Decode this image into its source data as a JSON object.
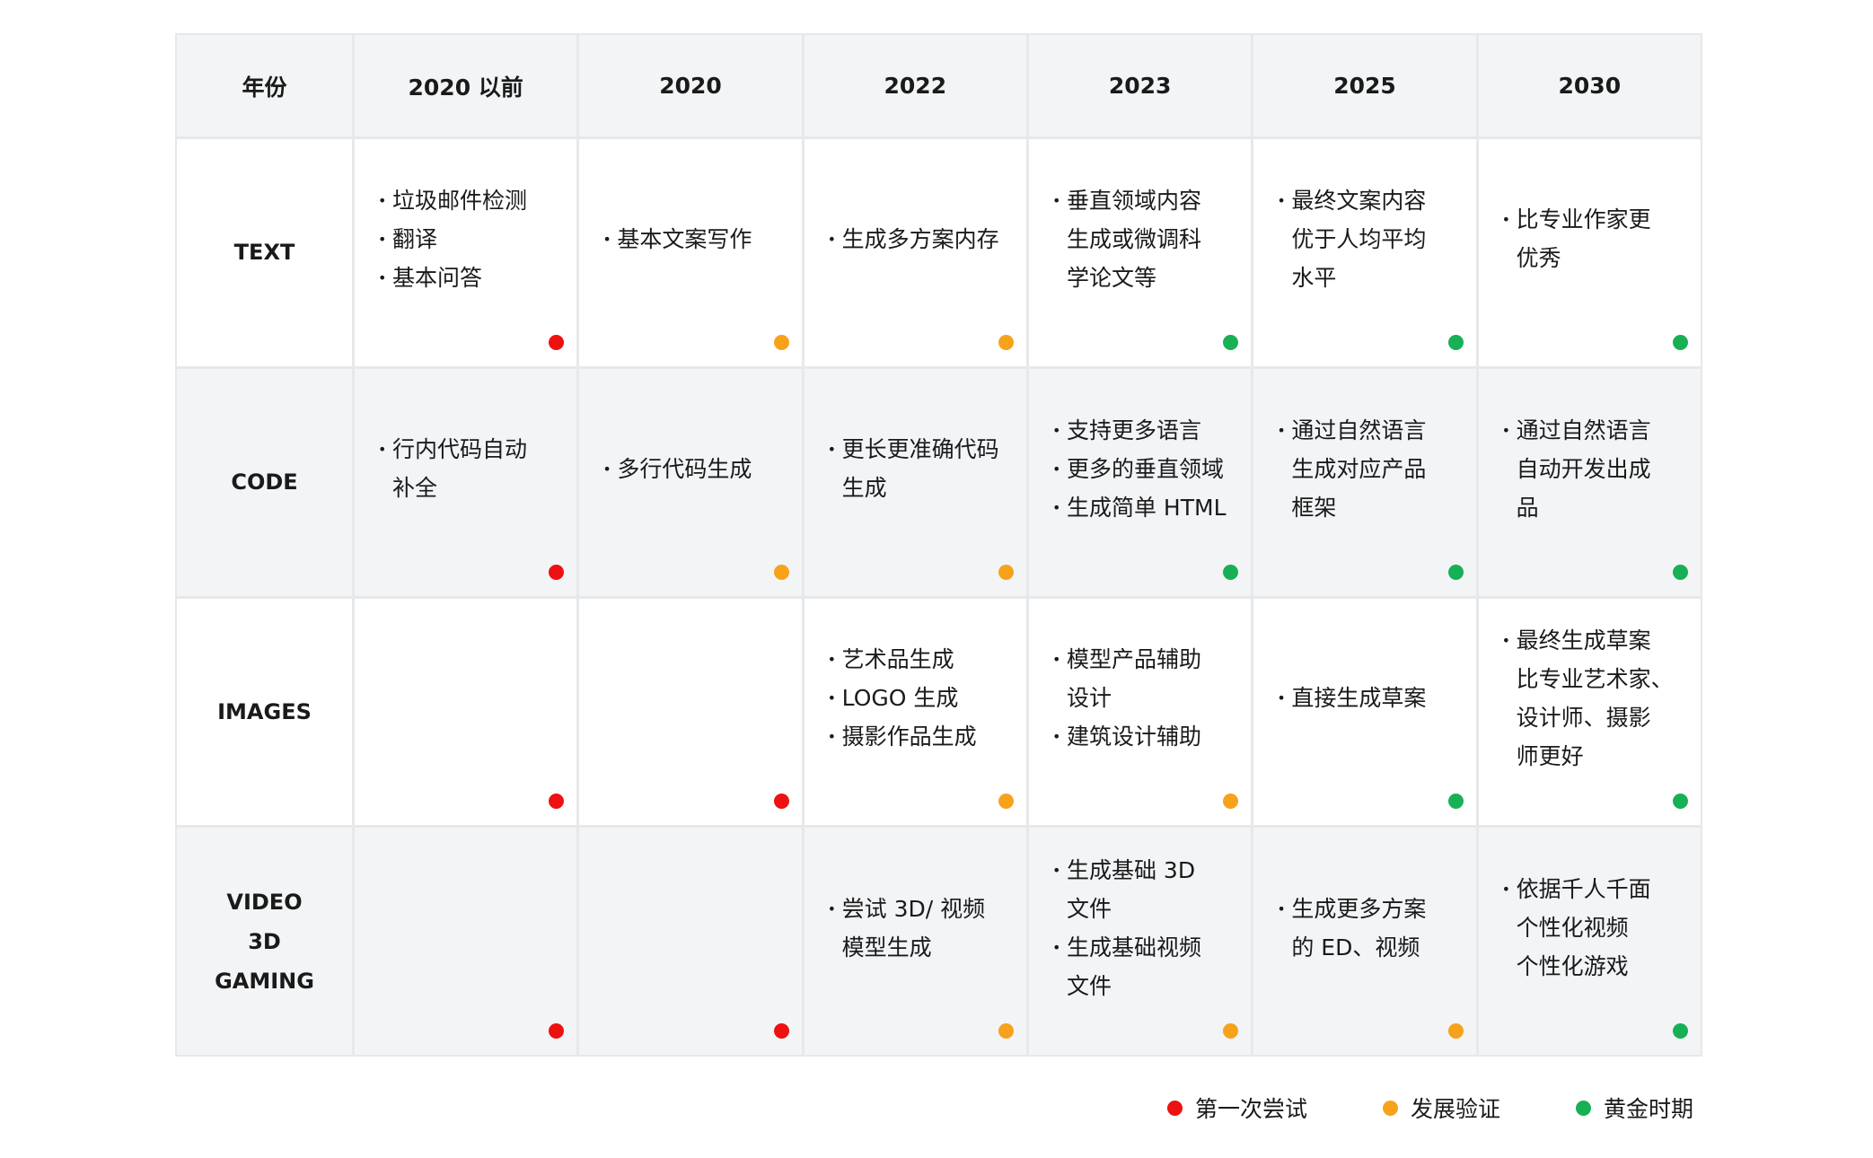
{
  "header": {
    "corner": "年份",
    "years": [
      "2020 以前",
      "2020",
      "2022",
      "2023",
      "2025",
      "2030"
    ]
  },
  "colors": {
    "first_try": "#ee1111",
    "validation": "#f7a21b",
    "golden": "#17b055"
  },
  "rows": [
    {
      "label": "TEXT",
      "cells": [
        {
          "items": [
            "垃圾邮件检测",
            "翻译",
            "基本问答"
          ],
          "status": "first_try"
        },
        {
          "items": [
            "基本文案写作"
          ],
          "status": "validation"
        },
        {
          "items": [
            "生成多方案内存"
          ],
          "status": "validation"
        },
        {
          "items": [
            "垂直领域内容\n生成或微调科\n学论文等"
          ],
          "status": "golden"
        },
        {
          "items": [
            "最终文案内容\n优于人均平均\n水平"
          ],
          "status": "golden"
        },
        {
          "items": [
            "比专业作家更\n优秀"
          ],
          "status": "golden"
        }
      ]
    },
    {
      "label": "CODE",
      "cells": [
        {
          "items": [
            "行内代码自动\n补全"
          ],
          "status": "first_try"
        },
        {
          "items": [
            "多行代码生成"
          ],
          "status": "validation"
        },
        {
          "items": [
            "更长更准确代码\n生成"
          ],
          "status": "validation"
        },
        {
          "items": [
            "支持更多语言",
            "更多的垂直领域",
            "生成简单 HTML"
          ],
          "status": "golden"
        },
        {
          "items": [
            "通过自然语言\n生成对应产品\n框架"
          ],
          "status": "golden"
        },
        {
          "items": [
            "通过自然语言\n自动开发出成\n品"
          ],
          "status": "golden"
        }
      ]
    },
    {
      "label": "IMAGES",
      "cells": [
        {
          "items": [],
          "status": "first_try"
        },
        {
          "items": [],
          "status": "first_try"
        },
        {
          "items": [
            "艺术品生成",
            "LOGO 生成",
            "摄影作品生成"
          ],
          "status": "validation"
        },
        {
          "items": [
            "模型产品辅助\n设计",
            "建筑设计辅助"
          ],
          "status": "validation"
        },
        {
          "items": [
            "直接生成草案"
          ],
          "status": "golden"
        },
        {
          "items": [
            "最终生成草案\n比专业艺术家、\n设计师、摄影\n师更好"
          ],
          "status": "golden"
        }
      ]
    },
    {
      "label": "VIDEO\n3D\nGAMING",
      "cells": [
        {
          "items": [],
          "status": "first_try"
        },
        {
          "items": [],
          "status": "first_try"
        },
        {
          "items": [
            "尝试 3D/ 视频\n模型生成"
          ],
          "status": "validation"
        },
        {
          "items": [
            "生成基础 3D\n文件",
            "生成基础视频\n文件"
          ],
          "status": "validation"
        },
        {
          "items": [
            "生成更多方案\n的 ED、视频"
          ],
          "status": "validation"
        },
        {
          "items": [
            "依据千人千面\n个性化视频\n个性化游戏"
          ],
          "status": "golden"
        }
      ]
    }
  ],
  "legend": [
    {
      "key": "first_try",
      "label": "第一次尝试"
    },
    {
      "key": "validation",
      "label": "发展验证"
    },
    {
      "key": "golden",
      "label": "黄金时期"
    }
  ]
}
